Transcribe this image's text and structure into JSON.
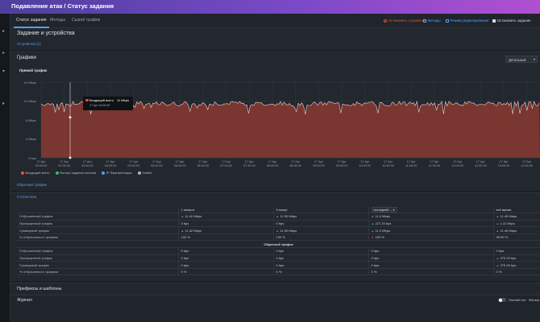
{
  "header": {
    "title": "Подавление атак / Статус задания"
  },
  "tabs": [
    {
      "label": "Статус задания",
      "active": true
    },
    {
      "label": "Методы"
    },
    {
      "label": "Сырой трафик"
    }
  ],
  "actions": {
    "stop_mitigation": "Остановить отражение",
    "methods": "Методы",
    "edit_mode": "Режим редактирования",
    "stop_task": "Остановить задание"
  },
  "task_section": {
    "title": "Задание и устройства",
    "devices_link": "Устройства (1)"
  },
  "graphs": {
    "title": "Графики",
    "view_select": "Детальный",
    "back_traffic_link": "Обратный трафик"
  },
  "chart_data": {
    "type": "area",
    "title": "Прямой трафик",
    "y_ticks": [
      "16 Mbps",
      "12 Mbps",
      "8 Mbps",
      "4 Mbps",
      "0 bps"
    ],
    "ylim": [
      0,
      16
    ],
    "yunit": "Mbps",
    "x_ticks": [
      [
        "17 Apr",
        "03:00:00"
      ],
      [
        "17 Apr",
        "03:30:00"
      ],
      [
        "17 Apr",
        "04:00:00"
      ],
      [
        "17 Apr",
        "04:30:00"
      ],
      [
        "17 Apr",
        "05:00:00"
      ],
      [
        "17 Apr",
        "05:30:00"
      ],
      [
        "17 Apr",
        "06:00:00"
      ],
      [
        "17 Apr",
        "06:30:00"
      ],
      [
        "17 Apr",
        "07:00:00"
      ],
      [
        "17 Apr",
        "07:30:00"
      ],
      [
        "17 Apr",
        "08:00:00"
      ],
      [
        "17 Apr",
        "08:30:00"
      ],
      [
        "17 Apr",
        "09:00:00"
      ],
      [
        "17 Apr",
        "09:30:00"
      ],
      [
        "17 Apr",
        "10:00:00"
      ],
      [
        "17 Apr",
        "10:30:00"
      ],
      [
        "17 Apr",
        "11:00:00"
      ],
      [
        "17 Apr",
        "11:30:00"
      ],
      [
        "17 Apr",
        "12:00:00"
      ],
      [
        "17 Apr",
        "12:30:00"
      ],
      [
        "17 Apr",
        "13:00:00"
      ],
      [
        "17 Apr",
        "13:30:00"
      ],
      [
        "17 Apr",
        "14:00:00"
      ]
    ],
    "series": [
      {
        "name": "Входящий всего",
        "color": "#e0533d",
        "approx_value_mbps": 11.4,
        "range_mbps": [
          9.2,
          11.9
        ]
      },
      {
        "name": "Фильтр задания очистки",
        "color": "#39b86b"
      },
      {
        "name": "IP Фрагментация",
        "color": "#4aa3ff"
      },
      {
        "name": "Зомби",
        "color": "#b5b5b5"
      }
    ],
    "tooltip": {
      "series": "Входящий всего",
      "value": "11 Mbps",
      "time": "17 Apr 03:00:00"
    },
    "grid": true,
    "legend": "bottom-left"
  },
  "stats": {
    "title": "Статистика",
    "columns": [
      "",
      "1 минута",
      "5 минут",
      "последний ...",
      "всё время"
    ],
    "rows": [
      {
        "label": "Отброшенный трафик",
        "values": [
          "11.42 Mbps",
          "11.90 Mbps",
          "11.0 Mbps",
          "11.45 Mbps"
        ],
        "trend": [
          "up",
          "up",
          "up",
          "up"
        ]
      },
      {
        "label": "Пропущенный трафик",
        "values": [
          "0 bps",
          "0 bps",
          "227.20 bps",
          "1.12 Kbps"
        ],
        "trend": [
          "",
          "",
          "up",
          "up"
        ]
      },
      {
        "label": "Суммарный трафик",
        "values": [
          "11.42 Mbps",
          "11.90 Mbps",
          "11.0 Mbps",
          "11.45 Mbps"
        ],
        "trend": [
          "up",
          "up",
          "up",
          "up"
        ]
      },
      {
        "label": "% отброшенного трафика",
        "values": [
          "100 %",
          "100 %",
          "100 %",
          "99.99 %"
        ],
        "trend": [
          "",
          "",
          "down",
          ""
        ]
      }
    ],
    "back_header": "Обратный трафик",
    "back_rows": [
      {
        "label": "Отброшенный трафик",
        "values": [
          "0 bps",
          "0 bps",
          "0 bps",
          "0 bps"
        ],
        "trend": [
          "",
          "",
          "",
          ""
        ]
      },
      {
        "label": "Пропущенный трафик",
        "values": [
          "0 bps",
          "0 bps",
          "0 bps",
          "270.29 bps"
        ],
        "trend": [
          "",
          "",
          "",
          "up"
        ]
      },
      {
        "label": "Суммарный трафик",
        "values": [
          "0 bps",
          "0 bps",
          "0 bps",
          "270.29 bps"
        ],
        "trend": [
          "",
          "",
          "",
          "up"
        ]
      },
      {
        "label": "% отброшенного трафика",
        "values": [
          "0 %",
          "0 %",
          "0 %",
          "0 %"
        ],
        "trend": [
          "",
          "",
          "",
          ""
        ]
      }
    ]
  },
  "prefixes": {
    "title": "Префиксы и шаблоны"
  },
  "journal": {
    "title": "Журнал",
    "full_log": "Полный лог",
    "filter": "Фильтр"
  }
}
